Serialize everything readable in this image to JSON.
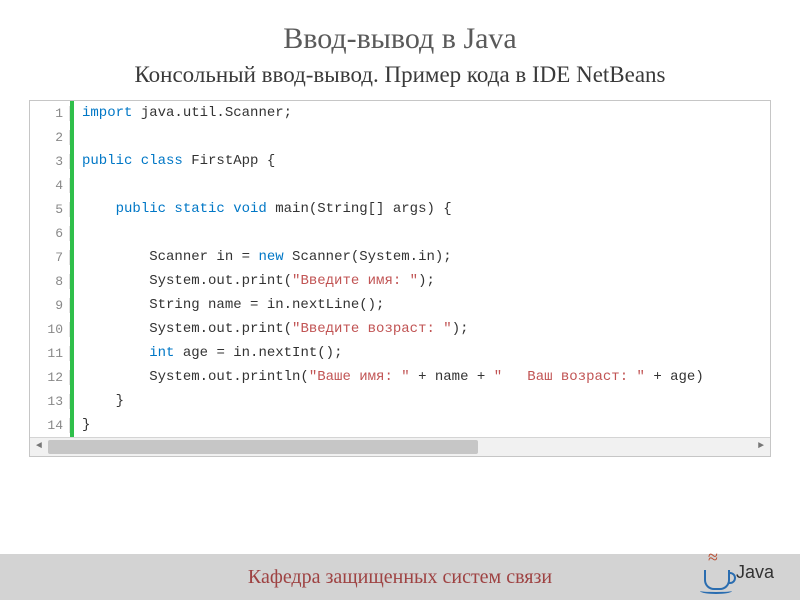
{
  "title": "Ввод-вывод в Java",
  "subtitle": "Консольный ввод-вывод. Пример кода в IDE NetBeans",
  "code": {
    "lines": [
      {
        "num": "1",
        "tokens": [
          [
            "kw",
            "import"
          ],
          [
            "plain",
            " java.util.Scanner;"
          ]
        ]
      },
      {
        "num": "2",
        "tokens": []
      },
      {
        "num": "3",
        "tokens": [
          [
            "kw",
            "public class"
          ],
          [
            "plain",
            " FirstApp {"
          ]
        ]
      },
      {
        "num": "4",
        "tokens": []
      },
      {
        "num": "5",
        "tokens": [
          [
            "plain",
            "    "
          ],
          [
            "kw",
            "public static void"
          ],
          [
            "plain",
            " main(String[] args) {"
          ]
        ]
      },
      {
        "num": "6",
        "tokens": []
      },
      {
        "num": "7",
        "tokens": [
          [
            "plain",
            "        Scanner in = "
          ],
          [
            "kw",
            "new"
          ],
          [
            "plain",
            " Scanner(System.in);"
          ]
        ]
      },
      {
        "num": "8",
        "tokens": [
          [
            "plain",
            "        System.out.print("
          ],
          [
            "str",
            "\"Введите имя: \""
          ],
          [
            "plain",
            ");"
          ]
        ]
      },
      {
        "num": "9",
        "tokens": [
          [
            "plain",
            "        String name = in.nextLine();"
          ]
        ]
      },
      {
        "num": "10",
        "tokens": [
          [
            "plain",
            "        System.out.print("
          ],
          [
            "str",
            "\"Введите возраст: \""
          ],
          [
            "plain",
            ");"
          ]
        ]
      },
      {
        "num": "11",
        "tokens": [
          [
            "plain",
            "        "
          ],
          [
            "kw",
            "int"
          ],
          [
            "plain",
            " age = in.nextInt();"
          ]
        ]
      },
      {
        "num": "12",
        "tokens": [
          [
            "plain",
            "        System.out.println("
          ],
          [
            "str",
            "\"Ваше имя: \""
          ],
          [
            "plain",
            " + name + "
          ],
          [
            "str",
            "\"   Ваш возраст: \""
          ],
          [
            "plain",
            " + age)"
          ]
        ]
      },
      {
        "num": "13",
        "tokens": [
          [
            "plain",
            "    }"
          ]
        ]
      },
      {
        "num": "14",
        "tokens": [
          [
            "plain",
            "}"
          ]
        ]
      }
    ]
  },
  "footer": {
    "department": "Кафедра защищенных систем связи",
    "logo_word": "Java"
  }
}
